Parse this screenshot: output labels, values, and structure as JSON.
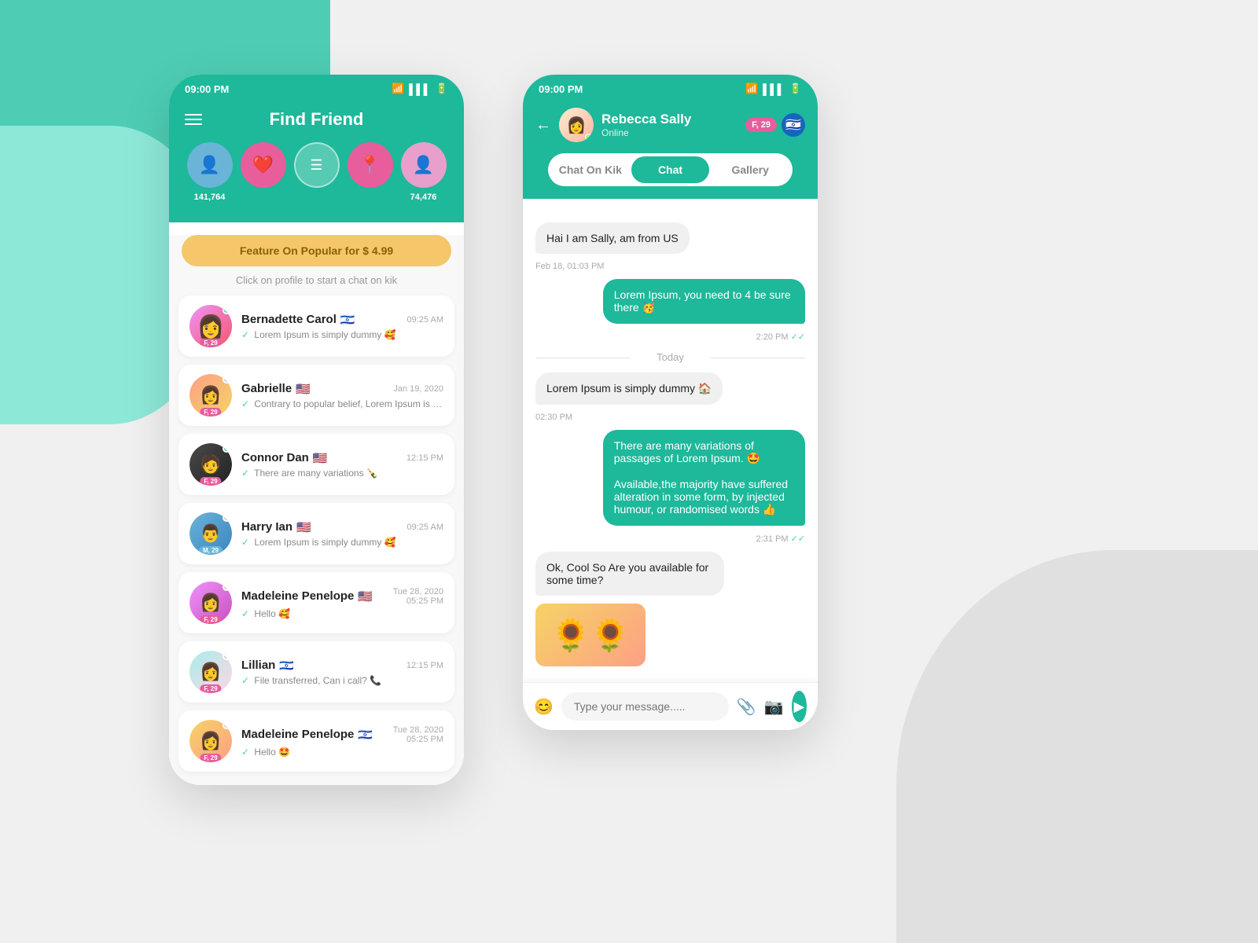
{
  "background": {
    "teal_color": "#4ecdb4",
    "gray_color": "#e0e0e0"
  },
  "left_phone": {
    "status_bar": {
      "time": "09:00 PM",
      "wifi_icon": "wifi",
      "signal_icon": "signal",
      "battery_icon": "battery"
    },
    "header": {
      "title": "Find Friend",
      "hamburger_icon": "hamburger"
    },
    "icons": [
      {
        "type": "blue",
        "icon": "👤",
        "count": "141,764"
      },
      {
        "type": "pink",
        "icon": "❤️",
        "count": ""
      },
      {
        "type": "outline",
        "icon": "☰",
        "count": ""
      },
      {
        "type": "pink_loc",
        "icon": "📍",
        "count": ""
      },
      {
        "type": "pink_light",
        "icon": "👤",
        "count": "74,476"
      }
    ],
    "feature_banner": "Feature On Popular for $ 4.99",
    "subtitle": "Click on profile to start a chat on kik",
    "chat_list": [
      {
        "name": "Bernadette Carol",
        "flag": "🇮🇱",
        "time": "09:25 AM",
        "preview": "Lorem Ipsum is simply dummy 🥰",
        "age_badge": "F, 29",
        "online": true,
        "avatar_class": "av-bernadette",
        "avatar_emoji": "👩"
      },
      {
        "name": "Gabrielle",
        "flag": "🇺🇸",
        "time": "Jan 19, 2020",
        "preview": "Contrary to popular belief, Lorem Ipsum is not simply random text. It has roots....",
        "age_badge": "F, 29",
        "online": false,
        "avatar_class": "av-gabrielle",
        "avatar_emoji": "👩"
      },
      {
        "name": "Connor Dan",
        "flag": "🇺🇸",
        "time": "12:15 PM",
        "preview": "There are many variations 🍾",
        "age_badge": "F, 29",
        "online": true,
        "avatar_class": "av-connor",
        "avatar_emoji": "🧑"
      },
      {
        "name": "Harry Ian",
        "flag": "🇺🇸",
        "time": "09:25 AM",
        "preview": "Lorem Ipsum is simply dummy 🥰",
        "age_badge": "M, 29",
        "online": false,
        "avatar_class": "av-harry",
        "avatar_emoji": "👨"
      },
      {
        "name": "Madeleine Penelope",
        "flag": "🇺🇸",
        "time": "Tue 28, 2020\n05:25 PM",
        "time_line1": "Tue 28, 2020",
        "time_line2": "05:25 PM",
        "preview": "Hello 🥰",
        "age_badge": "F, 29",
        "online": false,
        "avatar_class": "av-madeleine",
        "avatar_emoji": "👩"
      },
      {
        "name": "Lillian",
        "flag": "🇮🇱",
        "time": "12:15 PM",
        "preview": "File transferred, Can i call? 📞",
        "age_badge": "F, 29",
        "online": false,
        "avatar_class": "av-lillian",
        "avatar_emoji": "👩"
      },
      {
        "name": "Madeleine Penelope",
        "flag": "🇮🇱",
        "time": "Tue 28, 2020\n05:25 PM",
        "time_line1": "Tue 28, 2020",
        "time_line2": "05:25 PM",
        "preview": "Hello 🤩",
        "age_badge": "F, 29",
        "online": false,
        "avatar_class": "av-madeleine2",
        "avatar_emoji": "👩"
      }
    ]
  },
  "right_phone": {
    "status_bar": {
      "time": "09:00 PM"
    },
    "header": {
      "name": "Rebecca Sally",
      "status": "Online",
      "badge_f": "F, 29",
      "flag": "🇮🇱"
    },
    "tabs": [
      {
        "label": "Chat On Kik",
        "active": false
      },
      {
        "label": "Chat",
        "active": true
      },
      {
        "label": "Gallery",
        "active": false
      }
    ],
    "messages": [
      {
        "type": "received",
        "text": "Hai I am Sally, am from US",
        "time": null
      },
      {
        "type": "date_label",
        "text": "Feb 18, 01:03 PM"
      },
      {
        "type": "sent",
        "text": "Lorem Ipsum, you need to 4 be sure there 🥳",
        "time": "2:20 PM",
        "check": true
      },
      {
        "type": "divider",
        "text": "Today"
      },
      {
        "type": "received",
        "text": "Lorem Ipsum is simply dummy 🏠",
        "time": null
      },
      {
        "type": "date_label",
        "text": "02:30 PM"
      },
      {
        "type": "sent",
        "text": "There are many variations of passages of Lorem Ipsum. 🤩\n\nAvailable,the majority have suffered alteration in some form, by injected humour, or randomised words 👍",
        "time": "2:31 PM",
        "check": true
      },
      {
        "type": "received",
        "text": "Ok, Cool So Are you available for some time?",
        "time": null
      },
      {
        "type": "received_image",
        "text": "🌻",
        "time": null
      }
    ],
    "input": {
      "placeholder": "Type your message.....",
      "emoji_icon": "😊",
      "attach_icon": "📎",
      "camera_icon": "📷",
      "send_icon": "➤"
    }
  }
}
